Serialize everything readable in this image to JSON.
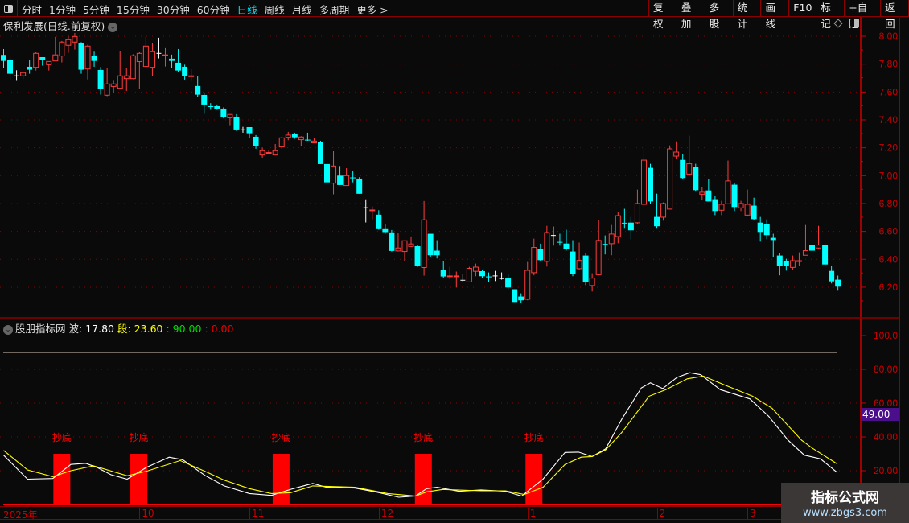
{
  "toolbar": {
    "periods": [
      "分时",
      "1分钟",
      "5分钟",
      "15分钟",
      "30分钟",
      "60分钟",
      "日线",
      "周线",
      "月线",
      "多周期",
      "更多 >"
    ],
    "active_period": "日线",
    "buttons": [
      "复权",
      "叠加",
      "多股",
      "统计",
      "画线",
      "F10",
      "标记",
      "+自选",
      "返回"
    ]
  },
  "stock": {
    "title": "保利发展(日线.前复权)"
  },
  "price_axis": {
    "labels": [
      "8.00",
      "7.80",
      "7.60",
      "7.40",
      "7.20",
      "7.00",
      "6.80",
      "6.60",
      "6.40",
      "6.20"
    ],
    "values": [
      8.0,
      7.8,
      7.6,
      7.4,
      7.2,
      7.0,
      6.8,
      6.6,
      6.4,
      6.2
    ]
  },
  "indicator": {
    "name": "股朋指标网",
    "wave_label": "波:",
    "wave_value": "17.80",
    "seg_label": "段:",
    "seg_value": "23.60",
    "level_high": ": 90.00",
    "level_low": ": 0.00",
    "current_value": "49.00",
    "axis_labels": [
      "100.0",
      "80.00",
      "60.00",
      "40.00",
      "20.00"
    ],
    "axis_values": [
      100,
      80,
      60,
      40,
      20
    ],
    "signal_label": "抄底"
  },
  "date_axis": [
    {
      "label": "2025年",
      "idx": 0
    },
    {
      "label": "10",
      "idx": 21
    },
    {
      "label": "11",
      "idx": 38
    },
    {
      "label": "12",
      "idx": 58
    },
    {
      "label": "1",
      "idx": 81
    },
    {
      "label": "2",
      "idx": 101
    },
    {
      "label": "3",
      "idx": 115
    }
  ],
  "watermark": {
    "line1": "指标公式网",
    "line2": "www.zbgs3.com"
  },
  "colors": {
    "up": "#ff3c3c",
    "down": "#00ffff",
    "doji": "#ffffff",
    "wave": "#ffffff",
    "seg": "#ffff00",
    "signal": "#ff0000",
    "grid": "#8b0000",
    "axis": "#cc0000"
  },
  "chart_data": [
    {
      "type": "candlestick",
      "title": "保利发展(日线.前复权)",
      "ylim": [
        6.1,
        8.05
      ],
      "ohlc_format": "[open,high,low,close]",
      "candles": [
        [
          7.866,
          7.908,
          7.77,
          7.823
        ],
        [
          7.827,
          7.85,
          7.68,
          7.731
        ],
        [
          7.716,
          7.756,
          7.68,
          7.716
        ],
        [
          7.716,
          7.746,
          7.693,
          7.739
        ],
        [
          7.781,
          7.827,
          7.731,
          7.76
        ],
        [
          7.777,
          7.885,
          7.754,
          7.877
        ],
        [
          7.85,
          7.85,
          7.789,
          7.827
        ],
        [
          7.796,
          7.82,
          7.754,
          7.819
        ],
        [
          7.823,
          7.995,
          7.823,
          7.866
        ],
        [
          7.858,
          7.966,
          7.812,
          7.958
        ],
        [
          7.935,
          8.004,
          7.881,
          7.975
        ],
        [
          7.958,
          8.023,
          7.904,
          7.998
        ],
        [
          7.948,
          7.958,
          7.731,
          7.76
        ],
        [
          7.765,
          7.939,
          7.69,
          7.929
        ],
        [
          7.862,
          7.889,
          7.781,
          7.823
        ],
        [
          7.758,
          7.779,
          7.581,
          7.62
        ],
        [
          7.577,
          7.773,
          7.57,
          7.658
        ],
        [
          7.64,
          7.681,
          7.593,
          7.658
        ],
        [
          7.627,
          7.896,
          7.62,
          7.716
        ],
        [
          7.696,
          7.773,
          7.608,
          7.716
        ],
        [
          7.696,
          7.871,
          7.692,
          7.86
        ],
        [
          7.818,
          7.885,
          7.62,
          7.877
        ],
        [
          7.783,
          7.995,
          7.783,
          7.929
        ],
        [
          7.777,
          7.952,
          7.712,
          7.889
        ],
        [
          7.877,
          7.989,
          7.841,
          7.877
        ],
        [
          7.862,
          7.914,
          7.783,
          7.866
        ],
        [
          7.839,
          7.868,
          7.77,
          7.823
        ],
        [
          7.81,
          7.908,
          7.744,
          7.754
        ],
        [
          7.781,
          7.796,
          7.689,
          7.712
        ],
        [
          7.712,
          7.764,
          7.68,
          7.716
        ],
        [
          7.643,
          7.712,
          7.562,
          7.581
        ],
        [
          7.579,
          7.591,
          7.443,
          7.51
        ],
        [
          7.498,
          7.52,
          7.472,
          7.494
        ],
        [
          7.498,
          7.51,
          7.472,
          7.481
        ],
        [
          7.481,
          7.49,
          7.412,
          7.418
        ],
        [
          7.414,
          7.439,
          7.362,
          7.439
        ],
        [
          7.418,
          7.441,
          7.321,
          7.331
        ],
        [
          7.329,
          7.35,
          7.308,
          7.329
        ],
        [
          7.348,
          7.348,
          7.273,
          7.304
        ],
        [
          7.279,
          7.291,
          7.193,
          7.212
        ],
        [
          7.148,
          7.202,
          7.129,
          7.179
        ],
        [
          7.164,
          7.187,
          7.154,
          7.166
        ],
        [
          7.148,
          7.227,
          7.148,
          7.179
        ],
        [
          7.206,
          7.279,
          7.195,
          7.271
        ],
        [
          7.275,
          7.314,
          7.254,
          7.291
        ],
        [
          7.302,
          7.308,
          7.264,
          7.275
        ],
        [
          7.258,
          7.283,
          7.21,
          7.277
        ],
        [
          7.258,
          7.308,
          7.25,
          7.254
        ],
        [
          7.235,
          7.268,
          7.235,
          7.248
        ],
        [
          7.239,
          7.25,
          7.083,
          7.083
        ],
        [
          7.083,
          7.091,
          6.935,
          6.952
        ],
        [
          6.946,
          7.175,
          6.866,
          7.069
        ],
        [
          7.0,
          7.069,
          6.933,
          6.933
        ],
        [
          6.929,
          7.054,
          6.929,
          7.0
        ],
        [
          6.987,
          7.031,
          6.952,
          6.983
        ],
        [
          6.979,
          6.989,
          6.87,
          6.87
        ],
        [
          6.77,
          6.83,
          6.664,
          6.77
        ],
        [
          6.75,
          6.779,
          6.687,
          6.754
        ],
        [
          6.72,
          6.752,
          6.612,
          6.622
        ],
        [
          6.622,
          6.65,
          6.583,
          6.595
        ],
        [
          6.593,
          6.61,
          6.456,
          6.46
        ],
        [
          6.46,
          6.587,
          6.456,
          6.481
        ],
        [
          6.456,
          6.533,
          6.385,
          6.533
        ],
        [
          6.492,
          6.564,
          6.492,
          6.51
        ],
        [
          6.494,
          6.5,
          6.346,
          6.35
        ],
        [
          6.341,
          6.818,
          6.283,
          6.683
        ],
        [
          6.583,
          6.583,
          6.419,
          6.429
        ],
        [
          6.462,
          6.537,
          6.406,
          6.429
        ],
        [
          6.323,
          6.387,
          6.267,
          6.277
        ],
        [
          6.277,
          6.346,
          6.258,
          6.281
        ],
        [
          6.277,
          6.312,
          6.198,
          6.281
        ],
        [
          6.25,
          6.294,
          6.238,
          6.25
        ],
        [
          6.238,
          6.346,
          6.238,
          6.335
        ],
        [
          6.314,
          6.369,
          6.279,
          6.344
        ],
        [
          6.315,
          6.323,
          6.267,
          6.279
        ],
        [
          6.277,
          6.306,
          6.238,
          6.273
        ],
        [
          6.281,
          6.317,
          6.244,
          6.281
        ],
        [
          6.262,
          6.306,
          6.254,
          6.262
        ],
        [
          6.265,
          6.294,
          6.185,
          6.198
        ],
        [
          6.185,
          6.185,
          6.094,
          6.094
        ],
        [
          6.133,
          6.156,
          6.088,
          6.106
        ],
        [
          6.113,
          6.381,
          6.106,
          6.321
        ],
        [
          6.304,
          6.548,
          6.285,
          6.485
        ],
        [
          6.473,
          6.512,
          6.388,
          6.394
        ],
        [
          6.385,
          6.64,
          6.348,
          6.592
        ],
        [
          6.571,
          6.635,
          6.498,
          6.571
        ],
        [
          6.525,
          6.583,
          6.498,
          6.521
        ],
        [
          6.513,
          6.612,
          6.463,
          6.473
        ],
        [
          6.456,
          6.537,
          6.279,
          6.296
        ],
        [
          6.333,
          6.52,
          6.327,
          6.392
        ],
        [
          6.427,
          6.444,
          6.215,
          6.238
        ],
        [
          6.212,
          6.3,
          6.169,
          6.265
        ],
        [
          6.29,
          6.681,
          6.285,
          6.535
        ],
        [
          6.51,
          6.571,
          6.435,
          6.506
        ],
        [
          6.512,
          6.646,
          6.429,
          6.581
        ],
        [
          6.563,
          6.738,
          6.515,
          6.713
        ],
        [
          6.662,
          6.762,
          6.625,
          6.658
        ],
        [
          6.663,
          6.704,
          6.544,
          6.608
        ],
        [
          6.662,
          6.9,
          6.65,
          6.8
        ],
        [
          6.794,
          7.196,
          6.765,
          7.111
        ],
        [
          7.056,
          7.085,
          6.796,
          6.815
        ],
        [
          6.704,
          6.871,
          6.625,
          6.637
        ],
        [
          6.702,
          6.808,
          6.677,
          6.8
        ],
        [
          6.76,
          7.217,
          6.76,
          7.192
        ],
        [
          7.14,
          7.246,
          7.117,
          7.169
        ],
        [
          7.113,
          7.154,
          6.977,
          6.983
        ],
        [
          7.011,
          7.287,
          6.996,
          7.085
        ],
        [
          7.062,
          7.085,
          6.885,
          6.896
        ],
        [
          6.867,
          6.917,
          6.827,
          6.881
        ],
        [
          6.894,
          6.975,
          6.815,
          6.815
        ],
        [
          6.831,
          6.854,
          6.717,
          6.746
        ],
        [
          6.752,
          6.819,
          6.717,
          6.794
        ],
        [
          6.798,
          7.108,
          6.798,
          6.962
        ],
        [
          6.935,
          6.95,
          6.746,
          6.775
        ],
        [
          6.769,
          6.819,
          6.746,
          6.8
        ],
        [
          6.717,
          6.9,
          6.708,
          6.794
        ],
        [
          6.785,
          6.842,
          6.679,
          6.688
        ],
        [
          6.663,
          6.704,
          6.527,
          6.596
        ],
        [
          6.652,
          6.687,
          6.544,
          6.573
        ],
        [
          6.554,
          6.583,
          6.415,
          6.538
        ],
        [
          6.427,
          6.444,
          6.285,
          6.354
        ],
        [
          6.387,
          6.404,
          6.319,
          6.354
        ],
        [
          6.342,
          6.427,
          6.325,
          6.39
        ],
        [
          6.387,
          6.45,
          6.354,
          6.39
        ],
        [
          6.429,
          6.646,
          6.429,
          6.462
        ],
        [
          6.502,
          6.612,
          6.458,
          6.462
        ],
        [
          6.481,
          6.64,
          6.475,
          6.502
        ],
        [
          6.502,
          6.512,
          6.348,
          6.363
        ],
        [
          6.317,
          6.352,
          6.227,
          6.242
        ],
        [
          6.254,
          6.283,
          6.175,
          6.204
        ]
      ]
    },
    {
      "type": "line",
      "title": "股朋指标网",
      "ylim": [
        0,
        100
      ],
      "x_unit": "candle index",
      "series": [
        {
          "name": "波",
          "points": [
            [
              0,
              29.2
            ],
            [
              3.7,
              15
            ],
            [
              7.6,
              15.4
            ],
            [
              10.4,
              23.7
            ],
            [
              12.7,
              24.4
            ],
            [
              14.4,
              22
            ],
            [
              16.6,
              17.6
            ],
            [
              19.1,
              15
            ],
            [
              22.1,
              22
            ],
            [
              25.6,
              28
            ],
            [
              27.7,
              26.5
            ],
            [
              31.1,
              17.3
            ],
            [
              34.1,
              11
            ],
            [
              38,
              6.5
            ],
            [
              41.4,
              5.4
            ],
            [
              44.4,
              9
            ],
            [
              47.8,
              12.5
            ],
            [
              49.9,
              10.2
            ],
            [
              54.3,
              9.7
            ],
            [
              57.7,
              7.3
            ],
            [
              61.1,
              4.3
            ],
            [
              63.7,
              5
            ],
            [
              65.4,
              9.4
            ],
            [
              67,
              10.2
            ],
            [
              70.4,
              7.8
            ],
            [
              73.8,
              8.6
            ],
            [
              77.6,
              7.8
            ],
            [
              80.1,
              5
            ],
            [
              83.4,
              15
            ],
            [
              86.8,
              30.8
            ],
            [
              88.9,
              31
            ],
            [
              91,
              28.4
            ],
            [
              93.1,
              33
            ],
            [
              95.6,
              50.6
            ],
            [
              98.6,
              69
            ],
            [
              100,
              72
            ],
            [
              101.9,
              68.6
            ],
            [
              104.1,
              75.2
            ],
            [
              106.1,
              78
            ],
            [
              107.8,
              76.8
            ],
            [
              110.8,
              68
            ],
            [
              115.4,
              62.5
            ],
            [
              118.3,
              52.2
            ],
            [
              121.3,
              38
            ],
            [
              123.8,
              29.2
            ],
            [
              126.3,
              27
            ],
            [
              128.9,
              18.9
            ]
          ]
        },
        {
          "name": "段",
          "points": [
            [
              0,
              32
            ],
            [
              3.7,
              20.5
            ],
            [
              7.6,
              16.5
            ],
            [
              10.4,
              20
            ],
            [
              13.9,
              22.9
            ],
            [
              19.1,
              17
            ],
            [
              22.1,
              19.7
            ],
            [
              27.3,
              26
            ],
            [
              31.1,
              19.7
            ],
            [
              34.1,
              14.4
            ],
            [
              38,
              9.4
            ],
            [
              41.4,
              6.5
            ],
            [
              44.4,
              7
            ],
            [
              47.8,
              11
            ],
            [
              54.3,
              10.2
            ],
            [
              59.4,
              6.5
            ],
            [
              63.7,
              5
            ],
            [
              65.4,
              7.5
            ],
            [
              67.9,
              8.9
            ],
            [
              73.8,
              8.1
            ],
            [
              77.6,
              8.1
            ],
            [
              80.5,
              5.9
            ],
            [
              83.4,
              10.2
            ],
            [
              86.8,
              23.7
            ],
            [
              89.3,
              28
            ],
            [
              91,
              28.4
            ],
            [
              93.1,
              32.4
            ],
            [
              95.6,
              42.7
            ],
            [
              99.8,
              64.1
            ],
            [
              102.4,
              68
            ],
            [
              105.7,
              74.4
            ],
            [
              108.2,
              76
            ],
            [
              111.6,
              70.5
            ],
            [
              115.8,
              64.1
            ],
            [
              118.8,
              57
            ],
            [
              123.4,
              38
            ],
            [
              125.1,
              33.2
            ],
            [
              128.9,
              24
            ]
          ]
        }
      ],
      "levels": [
        90,
        0
      ],
      "signals": [
        {
          "idx": 9,
          "value": 30
        },
        {
          "idx": 20.9,
          "value": 30
        },
        {
          "idx": 42.9,
          "value": 30
        },
        {
          "idx": 64.9,
          "value": 30
        },
        {
          "idx": 82,
          "value": 30
        }
      ]
    }
  ]
}
